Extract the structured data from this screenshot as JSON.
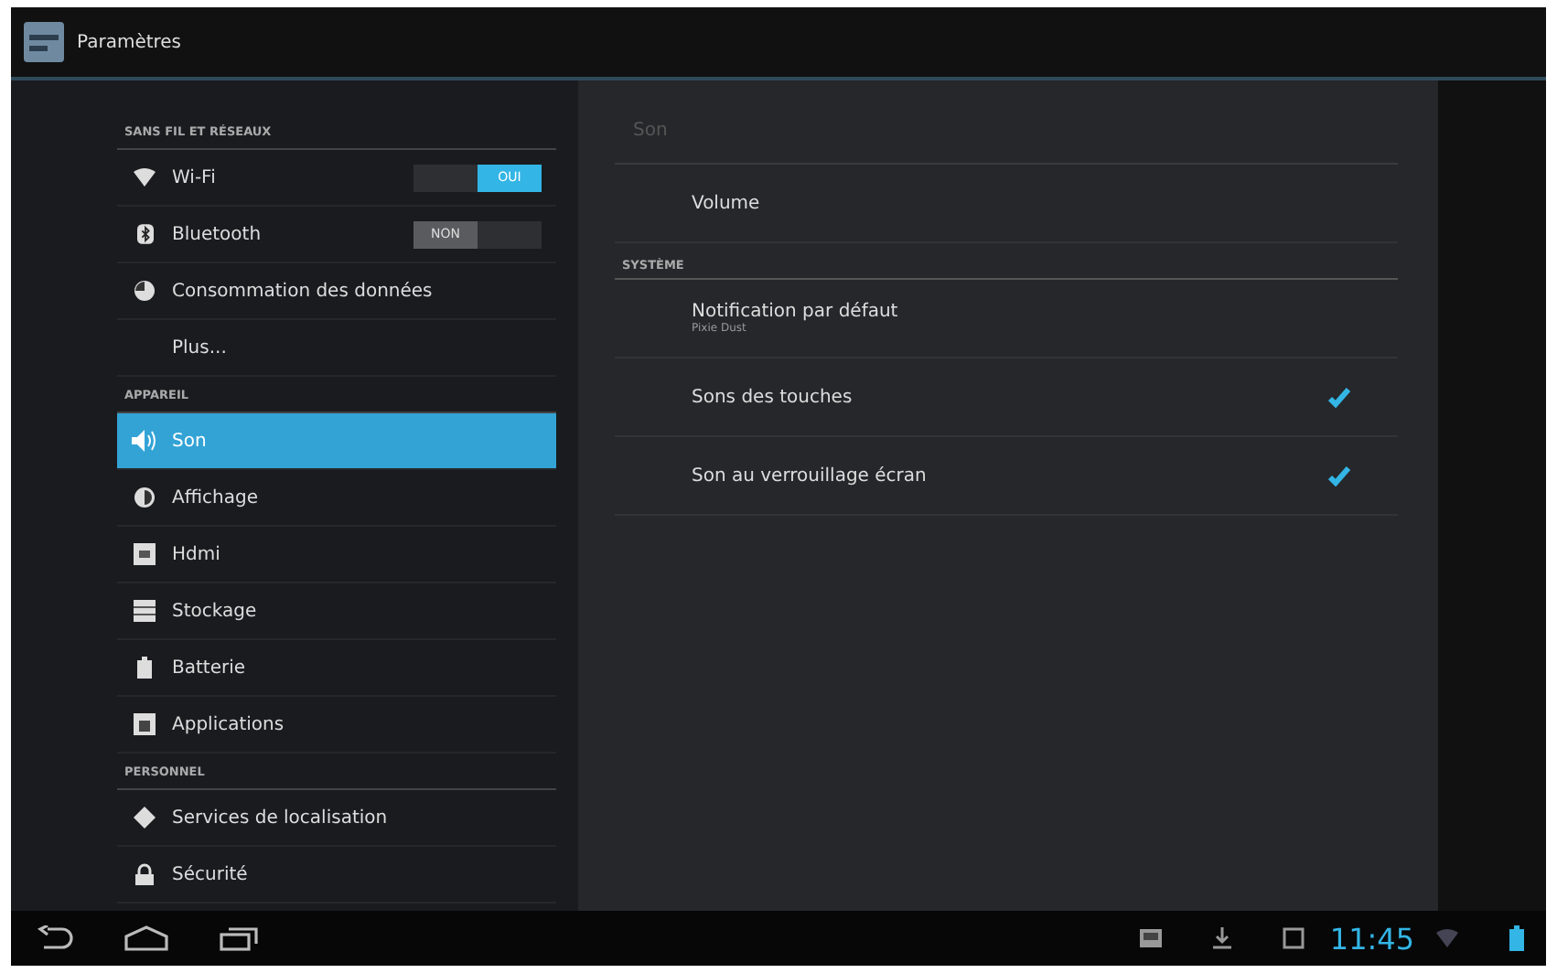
{
  "title_bar": {
    "title": "Paramètres"
  },
  "sidebar": [
    {
      "kind": "header",
      "label": "SANS FIL ET RÉSEAUX"
    },
    {
      "kind": "toggle",
      "label": "Wi-Fi",
      "on": true,
      "switch_text": "OUI",
      "selected": false
    },
    {
      "kind": "toggle",
      "label": "Bluetooth",
      "on": false,
      "switch_text": "NON",
      "selected": false
    },
    {
      "kind": "item",
      "label": "Consommation des données",
      "selected": false
    },
    {
      "kind": "item",
      "label": "Plus...",
      "selected": false
    },
    {
      "kind": "header",
      "label": "APPAREIL"
    },
    {
      "kind": "item",
      "label": "Son",
      "selected": true
    },
    {
      "kind": "item",
      "label": "Affichage",
      "selected": false
    },
    {
      "kind": "item",
      "label": "Hdmi",
      "selected": false
    },
    {
      "kind": "item",
      "label": "Stockage",
      "selected": false
    },
    {
      "kind": "item",
      "label": "Batterie",
      "selected": false
    },
    {
      "kind": "item",
      "label": "Applications",
      "selected": false
    },
    {
      "kind": "header",
      "label": "PERSONNEL"
    },
    {
      "kind": "item",
      "label": "Services de localisation",
      "selected": false
    },
    {
      "kind": "item",
      "label": "Sécurité",
      "selected": false
    }
  ],
  "detail": {
    "title": "Son",
    "rows": [
      {
        "kind": "item",
        "label": "Volume"
      },
      {
        "kind": "header",
        "label": "SYSTÈME"
      },
      {
        "kind": "item",
        "label": "Notification par défaut",
        "summary": "Pixie Dust"
      },
      {
        "kind": "check",
        "label": "Sons des touches",
        "checked": true
      },
      {
        "kind": "check",
        "label": "Son au verrouillage écran",
        "checked": true
      }
    ]
  },
  "status_bar": {
    "time": "11:45"
  }
}
